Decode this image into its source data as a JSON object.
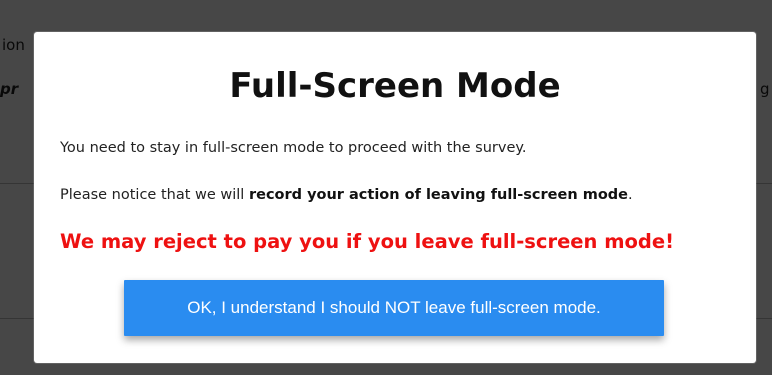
{
  "background": {
    "fragment_1": "ion",
    "fragment_2": "pr",
    "fragment_3": "g"
  },
  "modal": {
    "title": "Full-Screen Mode",
    "line_1": "You need to stay in full-screen mode to proceed with the survey.",
    "line_2_prefix": "Please notice that we will ",
    "line_2_bold": "record your action of leaving full-screen mode",
    "line_2_suffix": ".",
    "warning": "We may reject to pay you if you leave full-screen mode!",
    "ok_button_label": "OK, I understand I should NOT leave full-screen mode."
  },
  "colors": {
    "warning": "#ee1111",
    "button": "#2a8cf0",
    "overlay": "#4a4a4a"
  }
}
